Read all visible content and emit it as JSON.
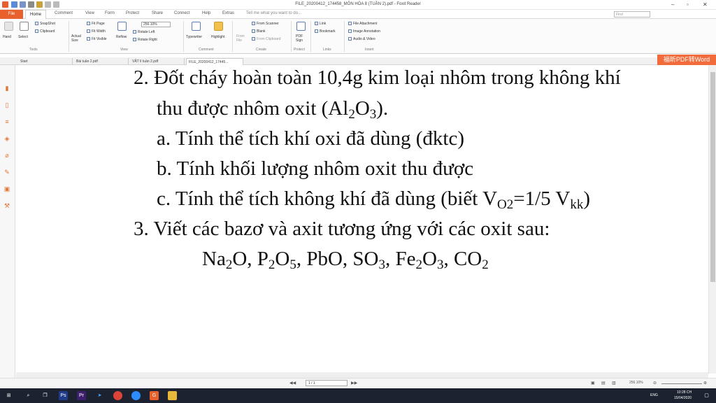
{
  "window": {
    "title": "FILE_20200412_174458_MÔN HÓA 8 (TUẦN 2).pdf - Foxit Reader"
  },
  "menu": {
    "tabs": [
      "File",
      "Home",
      "Comment",
      "View",
      "Form",
      "Protect",
      "Share",
      "Connect",
      "Help",
      "Extras"
    ],
    "tell_me": "Tell me what you want to do...",
    "find_placeholder": "Find"
  },
  "ribbon": {
    "hand": "Hand",
    "select": "Select",
    "snapshot": "SnapShot",
    "clipboard": "Clipboard",
    "actual_size": "Actual Size",
    "fit_page": "Fit Page",
    "fit_width": "Fit Width",
    "fit_visible": "Fit Visible",
    "reflow": "Reflow",
    "zoom": "256.10%",
    "rotate_left": "Rotate Left",
    "rotate_right": "Rotate Right",
    "typewriter": "Typewriter",
    "highlight": "Highlight",
    "from_file": "From File",
    "from_scanner": "From Scanner",
    "blank": "Blank",
    "from_clipboard": "From Clipboard",
    "pdf_sign": "PDF Sign",
    "link": "Link",
    "bookmark": "Bookmark",
    "file_attachment": "File Attachment",
    "image_annotation": "Image Annotation",
    "audio_video": "Audio & Video",
    "groups": {
      "tools": "Tools",
      "view": "View",
      "comment": "Comment",
      "create": "Create",
      "protect": "Protect",
      "links": "Links",
      "insert": "Insert"
    }
  },
  "doc_tabs": [
    "Start",
    "Bài tuần 2.pdf",
    "VẬT lí tuần 2.pdf",
    "FILE_20200412_17445..."
  ],
  "pdf_to_word": "福昕PDF转Word",
  "document": {
    "q2_line": "2. Đốt cháy hoàn toàn 10,4g kim loại nhôm trong không khí",
    "q2_line2_pre": "thu được nhôm oxit (Al",
    "q2_sub1": "2",
    "q2_mid": "O",
    "q2_sub2": "3",
    "q2_end": ").",
    "q2a": "a. Tính thể tích khí oxi đã dùng (đktc)",
    "q2b": "b. Tính khối lượng nhôm oxit thu được",
    "q2c_pre": "c. Tính thể tích không khí đã dùng (biết V",
    "q2c_sub1": "O2",
    "q2c_mid": "=1/5 V",
    "q2c_sub2": "kk",
    "q2c_end": ")",
    "q3": "3. Viết các bazơ và axit tương ứng với các oxit sau:",
    "oxides": [
      "Na",
      "2",
      "O,  P",
      "2",
      "O",
      "5",
      ",  PbO,  SO",
      "3",
      ",  Fe",
      "2",
      "O",
      "3",
      ",  CO",
      "2"
    ]
  },
  "status": {
    "page": "1 / 1",
    "zoom": "256.10%"
  },
  "taskbar": {
    "time": "10:28 CH",
    "date": "15/04/2020",
    "lang": "ENG"
  }
}
